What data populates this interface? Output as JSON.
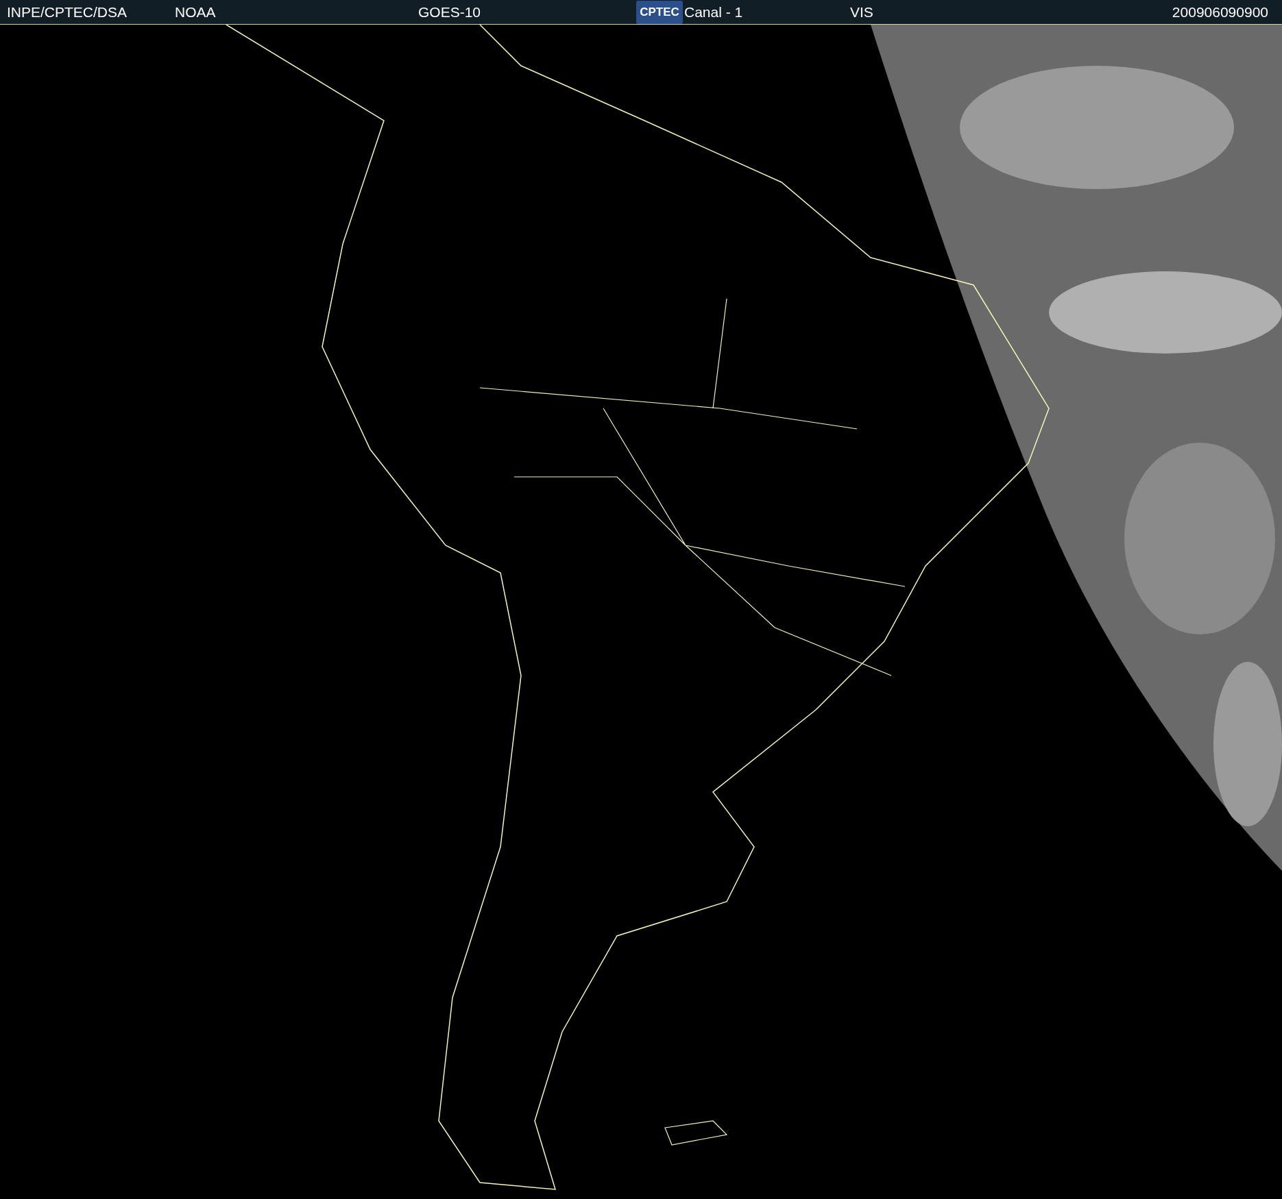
{
  "header": {
    "source": "INPE/CPTEC/DSA",
    "agency": "NOAA",
    "satellite": "GOES-10",
    "logo": "CPTEC",
    "channel": "Canal - 1",
    "band": "VIS",
    "timestamp": "200906090900"
  }
}
